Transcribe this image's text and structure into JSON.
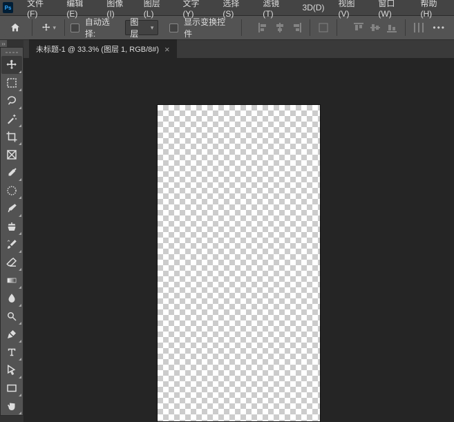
{
  "app": {
    "logo_text": "Ps"
  },
  "menu": [
    "文件(F)",
    "编辑(E)",
    "图像(I)",
    "图层(L)",
    "文字(Y)",
    "选择(S)",
    "滤镜(T)",
    "3D(D)",
    "视图(V)",
    "窗口(W)",
    "帮助(H)"
  ],
  "options": {
    "auto_select_label": "自动选择:",
    "auto_select_value": "图层",
    "show_transform_label": "显示变换控件"
  },
  "document": {
    "tab_title": "未标题-1 @ 33.3% (图层 1, RGB/8#)"
  },
  "tools": [
    "move",
    "marquee",
    "lasso",
    "wand",
    "crop",
    "frame",
    "eyedropper",
    "heal",
    "brush",
    "stamp",
    "history",
    "eraser",
    "gradient",
    "blur",
    "dodge",
    "pen",
    "type",
    "path-select",
    "rectangle",
    "hand"
  ]
}
